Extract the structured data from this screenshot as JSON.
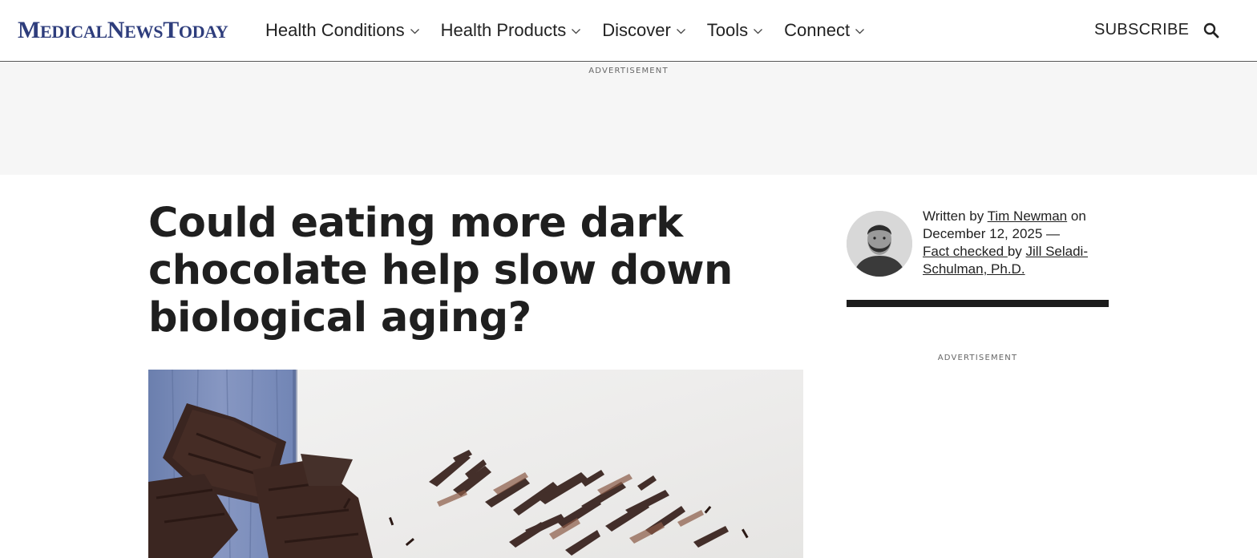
{
  "header": {
    "logo": {
      "m": "M",
      "edical": "EDICAL",
      "n": "N",
      "ews": "EWS",
      "t": "T",
      "oday": "ODAY"
    },
    "nav": [
      {
        "label": "Health Conditions",
        "icon": "chevron-down-icon"
      },
      {
        "label": "Health Products",
        "icon": "chevron-down-icon"
      },
      {
        "label": "Discover",
        "icon": "chevron-down-icon"
      },
      {
        "label": "Tools",
        "icon": "chevron-down-icon"
      },
      {
        "label": "Connect",
        "icon": "chevron-down-icon"
      }
    ],
    "subscribe_label": "SUBSCRIBE",
    "search_icon": "search-icon"
  },
  "ads": {
    "top_label": "ADVERTISEMENT",
    "side_label": "ADVERTISEMENT"
  },
  "article": {
    "headline": "Could eating more dark chocolate help slow down biological aging?",
    "hero_image": "dark chocolate pieces and shavings"
  },
  "byline": {
    "written_by": "Written by ",
    "author": "Tim Newman",
    "on": " on",
    "date": "December 12, 2025 —",
    "fact_checked": "Fact checked ",
    "by": "by ",
    "checker": "Jill Seladi-Schulman, Ph.D."
  },
  "colors": {
    "brand": "#2e3d7c",
    "text": "#222222",
    "ad_background": "#f6f6f6",
    "divider": "#1c1c1c"
  }
}
